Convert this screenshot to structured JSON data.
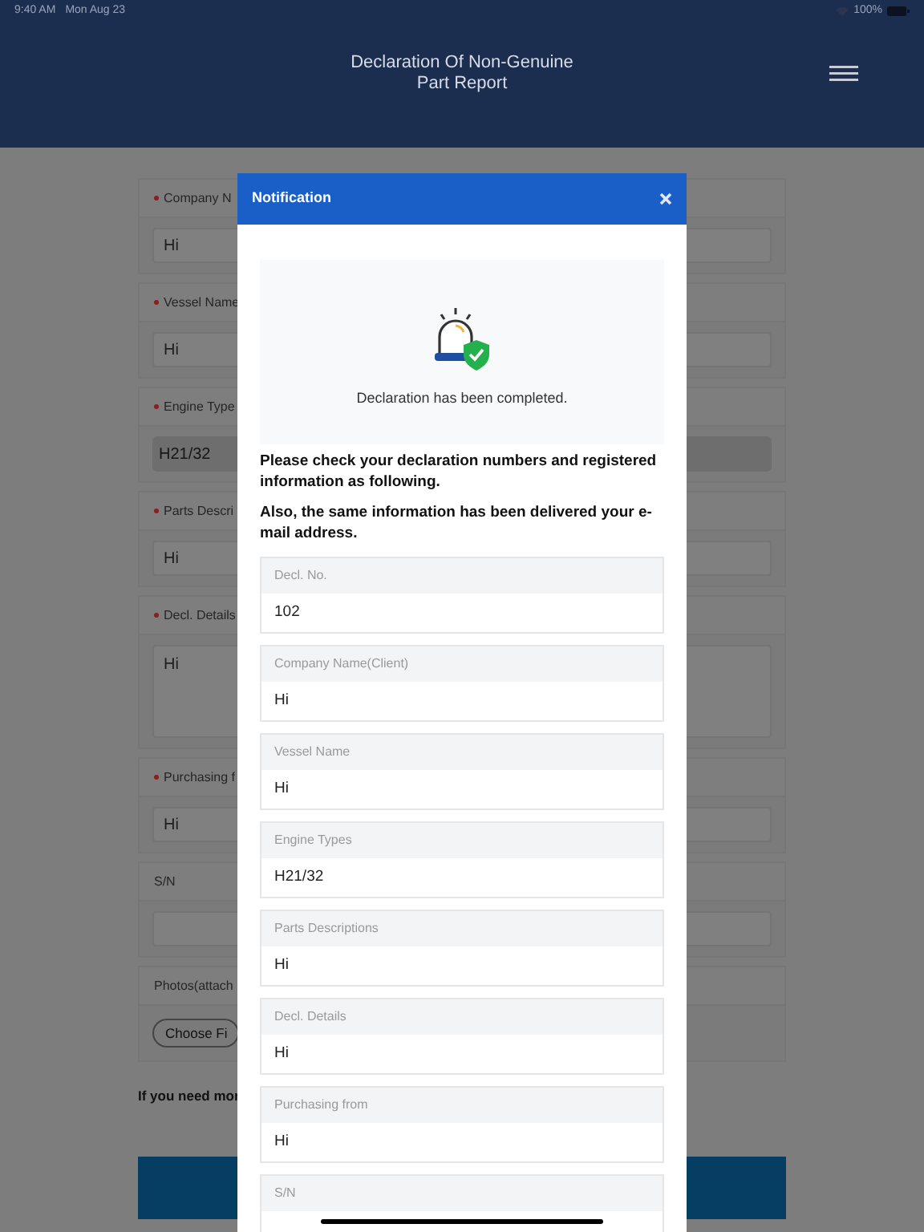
{
  "status_bar": {
    "time": "9:40 AM",
    "date": "Mon Aug 23",
    "battery": "100%"
  },
  "header": {
    "title": "Declaration Of Non-Genuine Part Report"
  },
  "form": {
    "fields": [
      {
        "label": "Company N",
        "required": true,
        "kind": "text",
        "value": "Hi"
      },
      {
        "label": "Vessel Name",
        "required": true,
        "kind": "text",
        "value": "Hi"
      },
      {
        "label": "Engine Type",
        "required": true,
        "kind": "select",
        "value": "H21/32"
      },
      {
        "label": "Parts Descri",
        "required": true,
        "kind": "text",
        "value": "Hi"
      },
      {
        "label": "Decl. Details",
        "required": true,
        "kind": "textarea",
        "value": "Hi"
      },
      {
        "label": "Purchasing f",
        "required": true,
        "kind": "text",
        "value": "Hi"
      },
      {
        "label": "S/N",
        "required": false,
        "kind": "text"
      },
      {
        "label": "Photos(attach",
        "required": false,
        "kind": "file",
        "value": "Choose Fi"
      }
    ],
    "note": "If you need mor"
  },
  "notification": {
    "title": "Notification",
    "message": "Declaration has been completed.",
    "paragraphs": [
      "Please check your declaration numbers and registered information as following.",
      "Also, the same information has been delivered your e-mail address."
    ],
    "fields": [
      {
        "label": "Decl. No.",
        "value": "102"
      },
      {
        "label": "Company Name(Client)",
        "value": "Hi"
      },
      {
        "label": "Vessel Name",
        "value": "Hi"
      },
      {
        "label": "Engine Types",
        "value": "H21/32"
      },
      {
        "label": "Parts Descriptions",
        "value": "Hi"
      },
      {
        "label": "Decl. Details",
        "value": "Hi"
      },
      {
        "label": "Purchasing from",
        "value": "Hi"
      },
      {
        "label": "S/N"
      }
    ]
  }
}
